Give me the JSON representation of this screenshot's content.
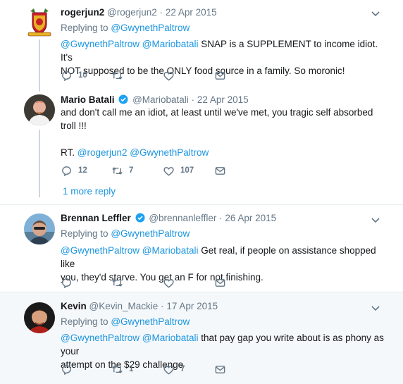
{
  "tweets": [
    {
      "name": "rogerjun2",
      "handle": "@rogerjun2",
      "dot": "·",
      "date": "22 Apr 2015",
      "replying_prefix": "Replying to",
      "replying_to": "@GwynethPaltrow",
      "mention1": "@GwynethPaltrow",
      "mention2": "@Mariobatali",
      "text_line1": " SNAP is a SUPPLEMENT to income idiot. It's",
      "text_line2": "NOT supposed to be the ONLY food source in a family. So moronic!",
      "reply_count": "10",
      "retweet_count": "",
      "like_count": ""
    },
    {
      "name": "Mario Batali",
      "verified": true,
      "handle": "@Mariobatali",
      "dot": "·",
      "date": "22 Apr 2015",
      "text_line1": "and don't call me an idiot, at least until we've met,   you tragic self absorbed",
      "text_line2": "troll !!!",
      "text_line3_prefix": "RT.",
      "mention1": "@rogerjun2",
      "mention2": "@GwynethPaltrow",
      "reply_count": "12",
      "retweet_count": "7",
      "like_count": "107"
    },
    {
      "name": "Brennan Leffler",
      "verified": true,
      "handle": "@brennanleffler",
      "dot": "·",
      "date": "26 Apr 2015",
      "replying_prefix": "Replying to",
      "replying_to": "@GwynethPaltrow",
      "mention1": "@GwynethPaltrow",
      "mention2": "@Mariobatali",
      "text_line1": " Get real, if people on assistance shopped like",
      "text_line2": "you, they'd starve. You get an F for not finishing.",
      "reply_count": "",
      "retweet_count": "",
      "like_count": ""
    },
    {
      "name": "Kevin",
      "handle": "@Kevin_Mackie",
      "dot": "·",
      "date": "17 Apr 2015",
      "replying_prefix": "Replying to",
      "replying_to": "@GwynethPaltrow",
      "mention1": "@GwynethPaltrow",
      "mention2": "@Mariobatali",
      "text_line1": " that pay gap you write about is as phony as your",
      "text_line2": "attempt on the $29 challenge",
      "reply_count": "",
      "retweet_count": "1",
      "like_count": "7"
    }
  ],
  "more_replies": "1 more reply",
  "colors": {
    "link": "#1b95e0",
    "secondary": "#657786",
    "thread_line": "#ccd6dd",
    "highlight_bg": "#f5f8fa"
  },
  "icons": [
    "reply-icon",
    "retweet-icon",
    "like-icon",
    "direct-message-icon",
    "caret-down-icon",
    "verified-badge-icon"
  ]
}
